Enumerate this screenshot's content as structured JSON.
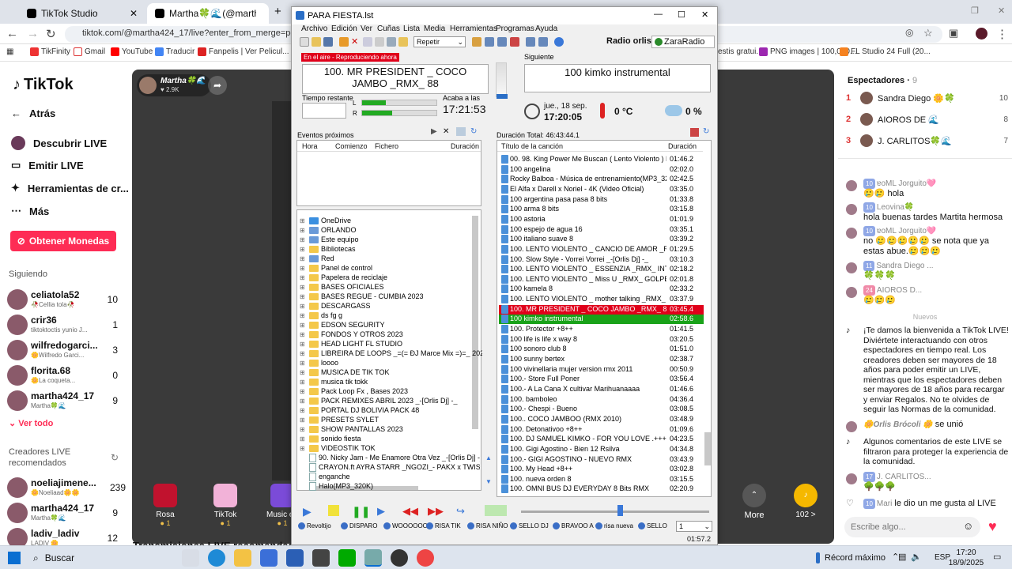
{
  "browser": {
    "tabs": [
      {
        "title": "TikTok Studio"
      },
      {
        "title": "Martha🍀🌊(@martha42"
      }
    ],
    "url": "tiktok.com/@martha424_17/live?enter_from_merge=personal_h",
    "bookmarks": [
      "TikFinity",
      "Gmail",
      "YouTube",
      "Traducir",
      "Fanpelis | Ver Pelicul...",
      "PNG images | 100,000...",
      "FL Studio 24 Full (20..."
    ],
    "bookmarks_extra": "estis gratui..."
  },
  "tiktok": {
    "logo": "TikTok",
    "nav": [
      "Atrás",
      "Descubrir LIVE",
      "Emitir LIVE",
      "Herramientas de cr...",
      "Más"
    ],
    "coins_button": "Obtener Monedas",
    "following_title": "Siguiendo",
    "following": [
      {
        "name": "celiatola52",
        "sub": "🥀CeIlia tola🥀",
        "count": "10"
      },
      {
        "name": "crir36",
        "sub": "tiktoktoctis yunio J...",
        "count": "1"
      },
      {
        "name": "wilfredogarci...",
        "sub": "🌼Wilfredo Garci...",
        "count": "3"
      },
      {
        "name": "florita.68",
        "sub": "🌼La coqueta...",
        "count": "0"
      },
      {
        "name": "martha424_17",
        "sub": "Martha🍀🌊",
        "count": "9"
      }
    ],
    "see_all": "Ver todo",
    "creators_title": "Creadores LIVE recomendados",
    "creators": [
      {
        "name": "noeliajimene...",
        "sub": "🌼Noeliaad🌼🌼",
        "count": "239"
      },
      {
        "name": "martha424_17",
        "sub": "Martha🍀🌊",
        "count": "9"
      },
      {
        "name": "ladiv_ladiv",
        "sub": "LADIV 🌼",
        "count": "12"
      }
    ],
    "host_name": "Martha🍀🌊",
    "host_likes": "2.9K",
    "gifts": [
      {
        "name": "Rosa",
        "cost": "1"
      },
      {
        "name": "TikTok",
        "cost": "1"
      },
      {
        "name": "Music on",
        "cost": "1"
      }
    ],
    "more": "More",
    "coins_count": "102 >",
    "recommended_live": "Transmisiones LIVE recomendadas",
    "viewers_title": "Espectadores",
    "viewers_count": "9",
    "viewers": [
      {
        "rank": "1",
        "name": "Sandra Diego 🌼🍀",
        "score": "10"
      },
      {
        "rank": "2",
        "name": "AIOROS DE 🌊",
        "score": "8"
      },
      {
        "rank": "3",
        "name": "J. CARLITOS🍀🌊",
        "score": "7"
      }
    ],
    "chat": [
      {
        "name": "ɐoML Jorguito🩷",
        "badge": "10",
        "text": "🥲🥲 hola"
      },
      {
        "name": "Leovina🍀",
        "badge": "10",
        "text": "hola buenas tardes Martita hermosa"
      },
      {
        "name": "ɐoML Jorguito🩷",
        "badge": "10",
        "text": "no 🥲🥲🥲🥲🥲 se nota que ya estas abue.🥲🥲🥲"
      },
      {
        "name": "Sandra Diego ...",
        "badge": "11",
        "text": "🍀🍀🍀"
      },
      {
        "name": "AIOROS D...",
        "badge": "24",
        "text": "🥲🥲🥲"
      }
    ],
    "nuevos": "Nuevos",
    "welcome": "¡Te damos la bienvenida a TikTok LIVE! Diviértete interactuando con otros espectadores en tiempo real. Los creadores deben ser mayores de 18 años para poder emitir un LIVE, mientras que los espectadores deben ser mayores de 18 años para recargar y enviar Regalos. No te olvides de seguir las Normas de la comunidad.",
    "joined_name": "🌼Orlis Brócoli 🌼",
    "joined_text": "se unió",
    "filter_notice": "Algunos comentarios de este LIVE se filtraron para proteger la experiencia de la comunidad.",
    "chat2": [
      {
        "name": "J. CARLITOS...",
        "badge": "17",
        "text": "🌳🌳🌳"
      },
      {
        "name": "Mari",
        "badge": "10",
        "text": "le dio un me gusta al LIVE"
      }
    ],
    "chat_placeholder": "Escribe algo..."
  },
  "zararadio": {
    "title": "PARA FIESTA.lst",
    "menu": [
      "Archivo",
      "Edición",
      "Ver",
      "Cuñas",
      "Lista",
      "Media",
      "Herramientas",
      "Programas",
      "Ayuda"
    ],
    "repeat_select": "Repetir",
    "radio_name": "Radio orlis",
    "brand": "ZaraRadio",
    "on_air_label": "En el aire - Reproduciendo ahora",
    "now_playing": "100. MR PRESIDENT _ COCO JAMBO _RMX_ 88",
    "next_label": "Siguiente",
    "next_song": "100 kimko instrumental",
    "remaining_label": "Tiempo restante",
    "ends_label": "Acaba a las",
    "ends_time": "17:21:53",
    "date": "jue., 18 sep.",
    "time": "17:20:05",
    "temperature": "0 °C",
    "humidity": "0 %",
    "events_title": "Eventos próximos",
    "events_columns": [
      "Hora",
      "Comienzo",
      "Fichero",
      "Duración"
    ],
    "total_duration": "Duración Total: 46:43:44.1",
    "playlist_columns": [
      "Título de la canción",
      "Duración"
    ],
    "tree": [
      {
        "name": "OneDrive",
        "type": "cloud"
      },
      {
        "name": "ORLANDO",
        "type": "user"
      },
      {
        "name": "Este equipo",
        "type": "pc"
      },
      {
        "name": "Bibliotecas",
        "type": "folder"
      },
      {
        "name": "Red",
        "type": "net"
      },
      {
        "name": "Panel de control",
        "type": "folder"
      },
      {
        "name": "Papelera de reciclaje",
        "type": "folder"
      },
      {
        "name": "BASES OFICIALES",
        "type": "folder"
      },
      {
        "name": "BASES REGUE - CUMBIA 2023",
        "type": "folder"
      },
      {
        "name": "DESCARGASS",
        "type": "folder"
      },
      {
        "name": "ds fg g",
        "type": "folder"
      },
      {
        "name": "EDSON SEGURITY",
        "type": "folder"
      },
      {
        "name": "FONDOS Y OTROS 2023",
        "type": "folder"
      },
      {
        "name": "HEAD LIGHT FL STUDIO",
        "type": "folder"
      },
      {
        "name": "LIBREIRA DE LOOPS _=(= ÐJ Marce Mix =)=_ 2023 VC",
        "type": "folder"
      },
      {
        "name": "loooo",
        "type": "folder"
      },
      {
        "name": "MUSICA DE TIK TOK",
        "type": "folder"
      },
      {
        "name": "musica tik tokk",
        "type": "folder"
      },
      {
        "name": "Pack Loop Fx , Bases 2023",
        "type": "folder"
      },
      {
        "name": "PACK REMIXES ABRIL 2023 _-[Orlis Dj] -_",
        "type": "folder"
      },
      {
        "name": "PORTAL DJ BOLIVIA PACK 48",
        "type": "folder"
      },
      {
        "name": "PRESETS SYLET",
        "type": "folder"
      },
      {
        "name": "SHOW PANTALLAS 2023",
        "type": "folder"
      },
      {
        "name": "sonido fiesta",
        "type": "folder"
      },
      {
        "name": "VIDEOSTIK TOK",
        "type": "folder"
      },
      {
        "name": "90. Nicky Jam - Me Enamore Otra Vez _-[Orlis Dj] -_",
        "type": "file"
      },
      {
        "name": "CRAYON.ft AYRA STARR _NGOZI_- PAKX x TWISTER [",
        "type": "file"
      },
      {
        "name": "enganche",
        "type": "file"
      },
      {
        "name": "Halo(MP3_320K)",
        "type": "file"
      }
    ],
    "playlist": [
      {
        "title": "00. 98. King Power Me Buscan ( Lento Violento ) Deeja...",
        "dur": "01:46.2",
        "state": ""
      },
      {
        "title": "100 angelina",
        "dur": "02:02.0",
        "state": ""
      },
      {
        "title": "Rocky Balboa - Música de entrenamiento(MP3_320K)",
        "dur": "02:42.5",
        "state": ""
      },
      {
        "title": "El Alfa x Darell x Noriel - 4K (Video Oficial)",
        "dur": "03:35.0",
        "state": ""
      },
      {
        "title": "100 argentina pasa pasa 8 bits",
        "dur": "01:33.8",
        "state": ""
      },
      {
        "title": "100 arma 8 bits",
        "dur": "03:15.8",
        "state": ""
      },
      {
        "title": "100 astoria",
        "dur": "01:01.9",
        "state": ""
      },
      {
        "title": "100 espejo de agua 16",
        "dur": "03:35.1",
        "state": ""
      },
      {
        "title": "100 italiano suave 8",
        "dur": "03:39.2",
        "state": ""
      },
      {
        "title": "100. LENTO VIOLENTO _ CANCIO DE AMOR _RMX_ 88",
        "dur": "01:29.5",
        "state": ""
      },
      {
        "title": "100. Slow Style - Vorrei Vorrei _-[Orlis Dj] -_",
        "dur": "03:10.3",
        "state": ""
      },
      {
        "title": "100. LENTO VIOLENTO _ ESSENZIA _RMX_ INTRO_ GOL...",
        "dur": "02:18.2",
        "state": ""
      },
      {
        "title": "100. LENTO VIOLENTO _ Miss U _RMX_ GOLPE",
        "dur": "02:01.8",
        "state": ""
      },
      {
        "title": "100 kamela 8",
        "dur": "02:33.2",
        "state": ""
      },
      {
        "title": "100. LENTO VIOLENTO _ mother talking _RMX_ GOLPE",
        "dur": "03:37.9",
        "state": ""
      },
      {
        "title": "100. MR PRESIDENT _ COCO JAMBO _RMX_ 88",
        "dur": "03:45.4",
        "state": "playing"
      },
      {
        "title": "100 kimko instrumental",
        "dur": "02:58.6",
        "state": "next"
      },
      {
        "title": "100. Protector +8++",
        "dur": "01:41.5",
        "state": ""
      },
      {
        "title": "100 life is life x way 8",
        "dur": "03:20.5",
        "state": ""
      },
      {
        "title": "100 sonoro club 8",
        "dur": "01:51.0",
        "state": ""
      },
      {
        "title": "100 sunny bertex",
        "dur": "02:38.7",
        "state": ""
      },
      {
        "title": "100 vivinellaria mujer version rmx  2011",
        "dur": "00:50.9",
        "state": ""
      },
      {
        "title": "100.-  Store Full Poner",
        "dur": "03:56.4",
        "state": ""
      },
      {
        "title": "100.- A La Cana X cultivar Marihuanaaaa",
        "dur": "01:46.6",
        "state": ""
      },
      {
        "title": "100. bamboleo",
        "dur": "04:36.4",
        "state": ""
      },
      {
        "title": "100.- Chespi - Bueno",
        "dur": "03:08.5",
        "state": ""
      },
      {
        "title": "100.. COCO JAMBOO (RMX 2010)",
        "dur": "03:48.9",
        "state": ""
      },
      {
        "title": "100. Detonativoo +8++",
        "dur": "01:09.6",
        "state": ""
      },
      {
        "title": "100. DJ SAMUEL KIMKO - FOR YOU LOVE .+++8+++",
        "dur": "04:23.5",
        "state": ""
      },
      {
        "title": "100. Gigi Agostino - Bien 12 Rsilva",
        "dur": "04:34.8",
        "state": ""
      },
      {
        "title": "100.- GIGI AGOSTINO - NUEVO RMX",
        "dur": "03:43.9",
        "state": ""
      },
      {
        "title": "100. My Head +8++",
        "dur": "03:02.8",
        "state": ""
      },
      {
        "title": "100. nueva orden 8",
        "dur": "03:15.5",
        "state": ""
      },
      {
        "title": "100. OMNI BUS DJ EVERYDAY  8 Bits RMX",
        "dur": "02:20.9",
        "state": ""
      }
    ],
    "carts": [
      "Revoltijo",
      "DISPARO",
      "WOOOOOO",
      "RISA TIK",
      "RISA NIÑO",
      "SELLO DJ",
      "BRAVOO A",
      "risa nueva",
      "SELLO"
    ],
    "cart_page": "1",
    "elapsed": "01:57.2"
  },
  "taskbar": {
    "search": "Buscar",
    "weather": "Récord máximo",
    "lang": "ESP",
    "clock_time": "17:20",
    "clock_date": "18/9/2025"
  }
}
